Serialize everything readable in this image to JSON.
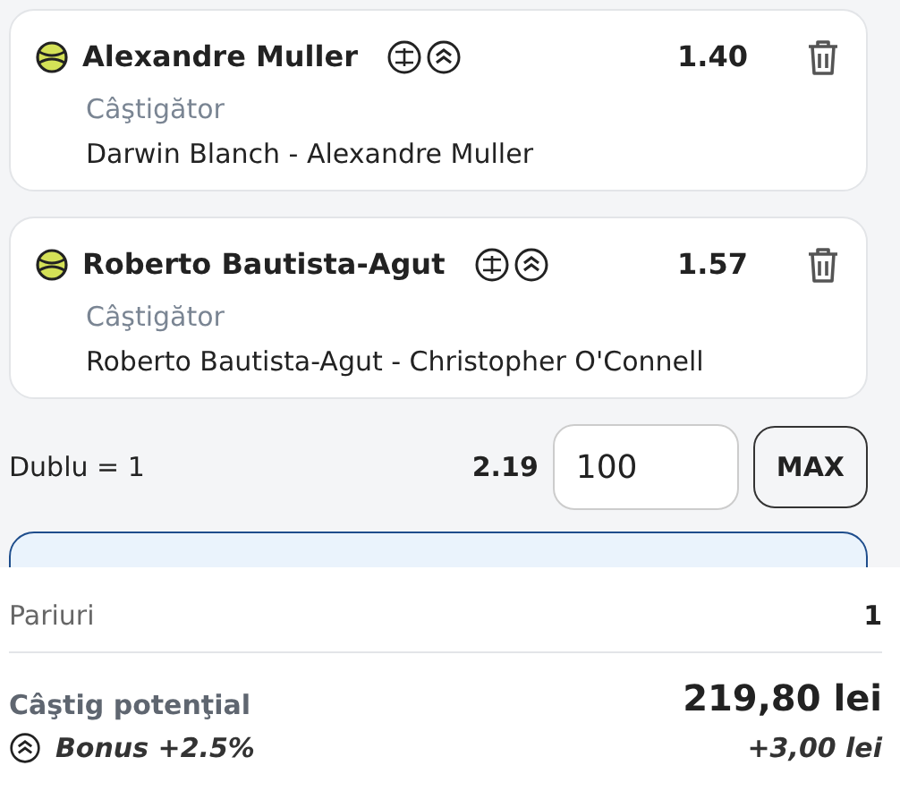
{
  "selections": [
    {
      "player": "Alexandre Muller",
      "odds": "1.40",
      "market": "Câştigător",
      "event": "Darwin Blanch - Alexandre Muller"
    },
    {
      "player": "Roberto Bautista-Agut",
      "odds": "1.57",
      "market": "Câştigător",
      "event": "Roberto Bautista-Agut - Christopher O'Connell"
    }
  ],
  "stake_row": {
    "label": "Dublu = 1",
    "odds": "2.19",
    "stake": "100",
    "max_button": "MAX"
  },
  "summary": {
    "bets_label": "Pariuri",
    "bets_value": "1",
    "potential_label": "Câştig potenţial",
    "potential_value": "219,80 lei",
    "bonus_label": "Bonus +2.5%",
    "bonus_value": "+3,00 lei"
  }
}
